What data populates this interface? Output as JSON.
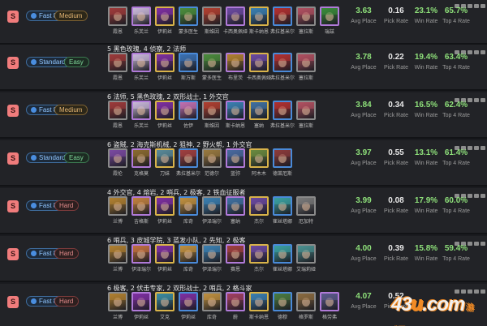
{
  "comps": [
    {
      "tier": "S",
      "speed": "Fast 8",
      "difficulty": "Medium",
      "traits": "",
      "units": [
        "霞恩",
        "乐芙兰",
        "伊莉丝",
        "蒙多医生",
        "斯维因",
        "卡西奥佩娅",
        "斯卡纳恩",
        "弗拉基米尔",
        "塞拉斯",
        "瑞兹"
      ],
      "colors": [
        "#9c3a3a",
        "#c8b8d8",
        "#7d2fa0",
        "#4b8c3c",
        "#b04030",
        "#6a4aa0",
        "#3b7fb0",
        "#b03030",
        "#b05060",
        "#3a8a3a"
      ],
      "stats": {
        "avg": "3.63",
        "pick": "0.16",
        "win": "23.1%",
        "top4": "65.7%"
      },
      "labels": {
        "avg": "Avg Place",
        "pick": "Pick Rate",
        "win": "Win Rate",
        "top4": "Top 4 Rate"
      }
    },
    {
      "tier": "S",
      "speed": "Standard",
      "difficulty": "Easy",
      "traits": "5 黑色玫瑰, 4 侦察, 2 法师",
      "units": [
        "霞恩",
        "乐芙兰",
        "伊莉丝",
        "斯万斯",
        "蒙多医生",
        "布里茨",
        "卡西奥佩娅",
        "弗拉基米尔",
        "塞拉斯"
      ],
      "colors": [
        "#9c3a3a",
        "#c8b8d8",
        "#7d2fa0",
        "#3b6fb0",
        "#4b8c3c",
        "#b08030",
        "#6a4aa0",
        "#b03030",
        "#b05060"
      ],
      "stats": {
        "avg": "3.78",
        "pick": "0.22",
        "win": "19.4%",
        "top4": "63.4%"
      },
      "labels": {
        "avg": "Avg Place",
        "pick": "Pick Rate",
        "win": "Win Rate",
        "top4": "Top 4 Rate"
      }
    },
    {
      "tier": "S",
      "speed": "Fast 8",
      "difficulty": "Medium",
      "traits": "6 法师, 5 黑色玫瑰, 2 双形战士, 1 外交官",
      "units": [
        "霞恩",
        "乐芙兰",
        "伊莉丝",
        "佐伊",
        "斯维因",
        "斯卡纳恩",
        "塞纳",
        "弗拉基米尔",
        "塞拉斯"
      ],
      "colors": [
        "#9c3a3a",
        "#c8b8d8",
        "#7d2fa0",
        "#c070b0",
        "#b04030",
        "#3b7fb0",
        "#4070a0",
        "#b03030",
        "#b05060"
      ],
      "stats": {
        "avg": "3.84",
        "pick": "0.34",
        "win": "16.5%",
        "top4": "62.4%"
      },
      "labels": {
        "avg": "Avg Place",
        "pick": "Pick Rate",
        "win": "Win Rate",
        "top4": "Top 4 Rate"
      }
    },
    {
      "tier": "S",
      "speed": "Standard",
      "difficulty": "Easy",
      "traits": "6 盗贼, 2 海克斯机械, 2 狙神, 2 野火帮, 1 外交官",
      "units": [
        "霞伦",
        "克格莫",
        "刀妹",
        "弗拉基米尔",
        "范德尔",
        "蓝弥",
        "阿木木",
        "德莱厄斯"
      ],
      "colors": [
        "#7a4aa0",
        "#8a6a30",
        "#5a8a9a",
        "#a04040",
        "#9a7a40",
        "#4a6aa0",
        "#6a8a40",
        "#8a3a3a"
      ],
      "stats": {
        "avg": "3.97",
        "pick": "0.55",
        "win": "13.1%",
        "top4": "61.4%"
      },
      "labels": {
        "avg": "Avg Place",
        "pick": "Pick Rate",
        "win": "Win Rate",
        "top4": "Top 4 Rate"
      }
    },
    {
      "tier": "S",
      "speed": "Fast 8",
      "difficulty": "Hard",
      "traits": "4 外交官, 4 熔岩, 2 哨兵, 2 极客, 2 铁血征服者",
      "units": [
        "兰博",
        "吉格斯",
        "伊莉丝",
        "库奇",
        "伊泽瑞尔",
        "塞纳",
        "杰尔",
        "崔丝塔娜",
        "厄加特"
      ],
      "colors": [
        "#b08030",
        "#c08040",
        "#7d2fa0",
        "#c09040",
        "#3b7fb0",
        "#4070a0",
        "#6a4aa0",
        "#3aa0a0",
        "#7a7a7a"
      ],
      "stats": {
        "avg": "3.99",
        "pick": "0.08",
        "win": "17.9%",
        "top4": "60.0%"
      },
      "labels": {
        "avg": "Avg Place",
        "pick": "Pick Rate",
        "win": "Win Rate",
        "top4": "Top 4 Rate"
      }
    },
    {
      "tier": "S",
      "speed": "Fast 8",
      "difficulty": "Hard",
      "traits": "6 哨兵, 3 皮城学院, 3 蓝发小队, 2 先知, 2 极客",
      "units": [
        "兰博",
        "伊泽瑞尔",
        "伊莉丝",
        "库奇",
        "伊泽瑞尔",
        "赛恩",
        "杰尔",
        "崔丝塔娜",
        "艾瑞莉娅"
      ],
      "colors": [
        "#b08030",
        "#c07040",
        "#7d2fa0",
        "#c09040",
        "#3b7fb0",
        "#a04040",
        "#6a4aa0",
        "#3aa0a0",
        "#4a9090"
      ],
      "stats": {
        "avg": "4.00",
        "pick": "0.39",
        "win": "15.8%",
        "top4": "59.4%"
      },
      "labels": {
        "avg": "Avg Place",
        "pick": "Pick Rate",
        "win": "Win Rate",
        "top4": "Top 4 Rate"
      }
    },
    {
      "tier": "S",
      "speed": "Fast 8",
      "difficulty": "Hard",
      "traits": "6 极客, 2 伏击专家, 2 双形战士, 2 哨兵, 2 格斗家",
      "units": [
        "兰博",
        "伊莉丝",
        "艾克",
        "伊莉丝",
        "库奇",
        "蔚",
        "斯卡纳恩",
        "德穆",
        "格罗斯",
        "格劳弗"
      ],
      "colors": [
        "#b08030",
        "#7d2fa0",
        "#3a8aa0",
        "#7d2fa0",
        "#c09040",
        "#a04060",
        "#3b7fb0",
        "#4a7a40",
        "#8a6a40",
        "#5a5a8a"
      ],
      "stats": {
        "avg": "4.07",
        "pick": "0.52",
        "win": "",
        "top4": ""
      },
      "labels": {
        "avg": "Avg Place",
        "pick": "Pick Rate",
        "win": "",
        "top4": ""
      }
    }
  ],
  "watermark": {
    "text": "43",
    "dot": "u",
    "suffix": ".com",
    "sub": "游戏网"
  }
}
